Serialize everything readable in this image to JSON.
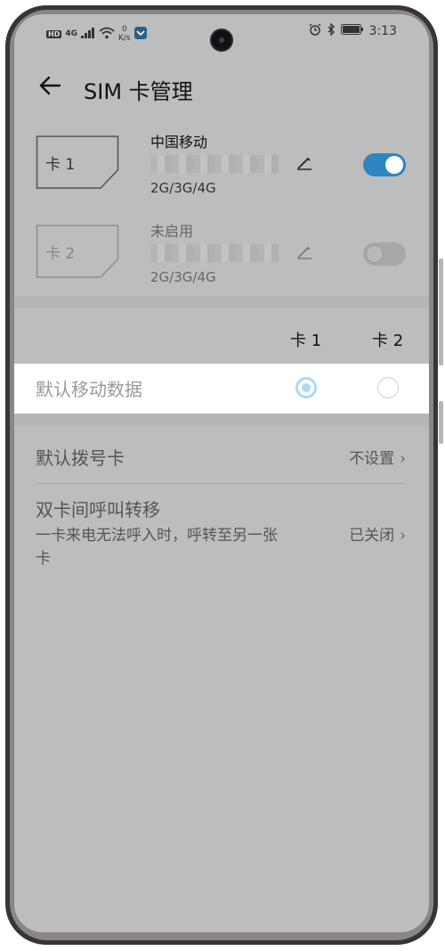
{
  "status_bar": {
    "hd": "HD",
    "net": "4G",
    "speed_value": "0",
    "speed_unit": "K/s",
    "time": "3:13"
  },
  "header": {
    "title": "SIM 卡管理"
  },
  "sims": [
    {
      "card_label": "卡 1",
      "carrier": "中国移动",
      "network": "2G/3G/4G",
      "enabled": true
    },
    {
      "card_label": "卡 2",
      "carrier": "未启用",
      "network": "2G/3G/4G",
      "enabled": false
    }
  ],
  "columns": {
    "card1": "卡 1",
    "card2": "卡 2"
  },
  "default_data": {
    "label": "默认移动数据",
    "selected": "card1"
  },
  "settings": [
    {
      "title": "默认拨号卡",
      "subtitle": "",
      "value": "不设置"
    },
    {
      "title": "双卡间呼叫转移",
      "subtitle": "一卡来电无法呼入时，呼转至另一张卡",
      "value": "已关闭"
    }
  ],
  "colors": {
    "accent": "#2e86c1",
    "toggle_off": "#aaaaaa",
    "radio_selected": "#a9d9f5",
    "overlay": "#bdbdbd"
  }
}
